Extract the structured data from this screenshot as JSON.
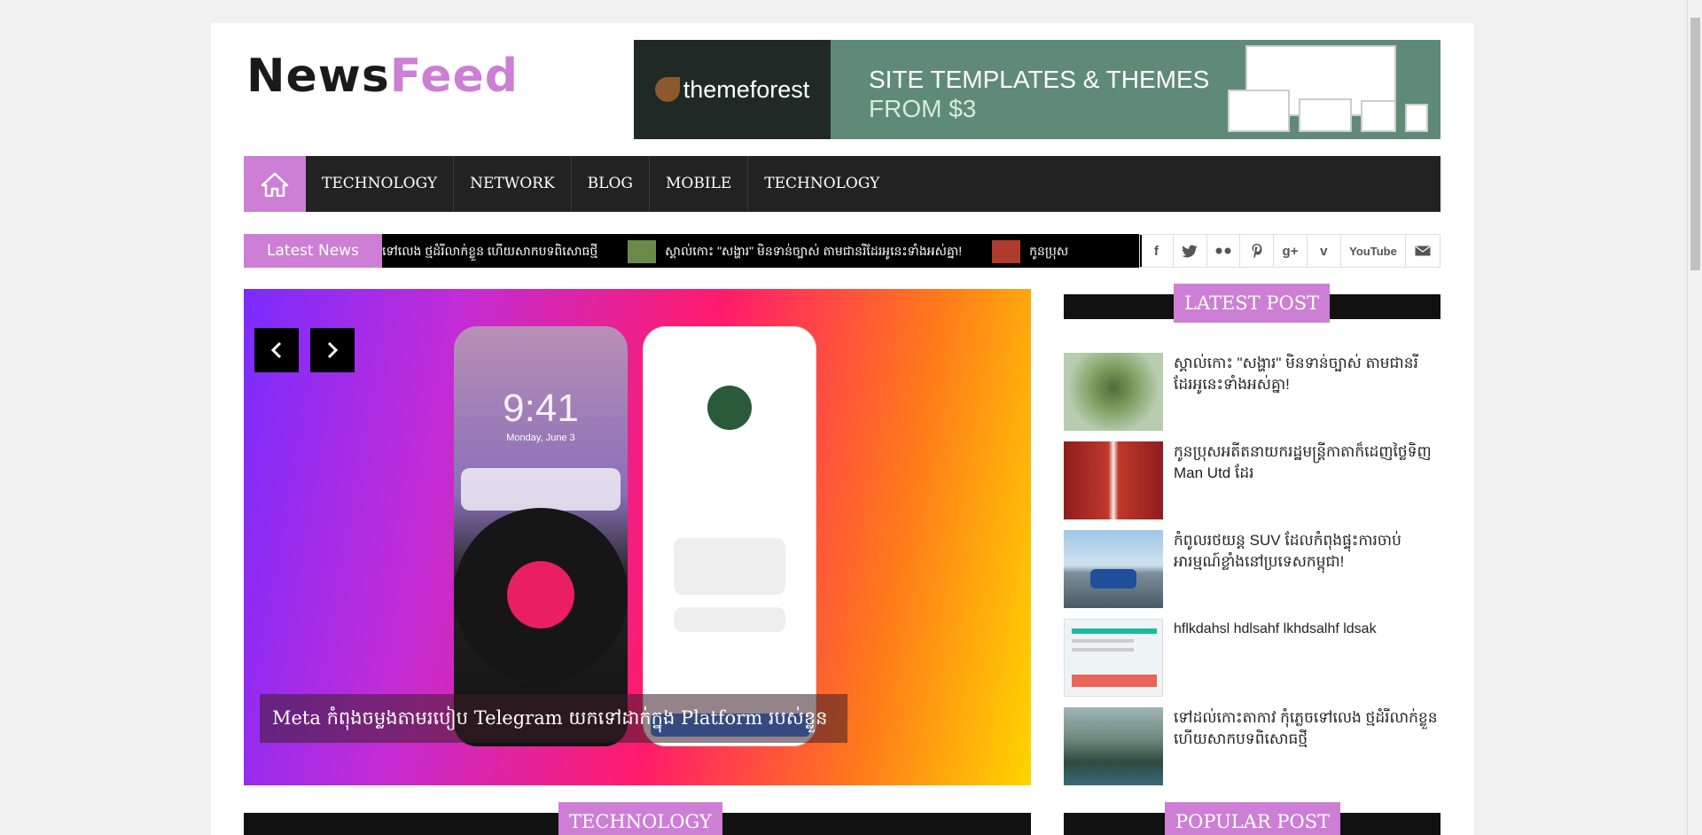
{
  "site": {
    "logo_part1": "News",
    "logo_part2": "Feed"
  },
  "banner": {
    "brand": "themeforest",
    "line1": "SITE TEMPLATES & THEMES",
    "line2": "FROM $3"
  },
  "nav": {
    "items": [
      "TECHNOLOGY",
      "NETWORK",
      "BLOG",
      "MOBILE",
      "TECHNOLOGY"
    ]
  },
  "ticker": {
    "label": "Latest News",
    "items": [
      "ទៅលេង ថ្មដំរីលាក់ខ្លួន ហើយសាកបទពិសោធថ្មី",
      "ស្គាល់កោះ \"សង្ហារ\" មិនទាន់ច្បាស់ តាមជានរីដែរអូនេះទាំងអស់គ្នា!",
      "កូនប្រុស"
    ]
  },
  "social": {
    "icons": [
      "facebook-icon",
      "twitter-icon",
      "flickr-icon",
      "pinterest-icon",
      "googleplus-icon",
      "vimeo-icon",
      "youtube-icon",
      "mail-icon"
    ],
    "youtube_label": "YouTube"
  },
  "slider": {
    "caption": "Meta កំពុងចម្លងតាមរបៀប Telegram យកទៅដាក់ក្នុង Platform របស់ខ្លួន",
    "phone_time": "9:41",
    "phone_day": "Monday, June 3"
  },
  "sections": {
    "technology": "TECHNOLOGY",
    "latest_post": "LATEST POST",
    "popular_post": "POPULAR POST"
  },
  "latest_posts": [
    {
      "title": "ស្គាល់កោះ \"សង្ហារ\" មិនទាន់ច្បាស់ តាមជានរីដែរអូនេះទាំងអស់គ្នា!",
      "color": "#8fb07a"
    },
    {
      "title": "កូនប្រុសអតីតនាយករដ្ឋមន្ត្រីកាតាក៏ដេញថ្លៃទិញ Man Utd ដែរ",
      "color": "#c0392b"
    },
    {
      "title": "កំពូលរថយន្ត SUV ដែលកំពុងផ្ទុះការចាប់អារម្មណ៍ខ្លាំងនៅប្រទេសកម្ពុជា!",
      "color": "#5a8fbf"
    },
    {
      "title": "hflkdahsl hdlsahf lkhdsalhf ldsak",
      "color": "#e8eef2"
    },
    {
      "title": "ទៅដល់កោះតាកាវ កុំភ្លេចទៅលេង ថ្មដំរីលាក់ខ្លួន ហើយសាកបទពិសោធថ្មី",
      "color": "#4f6b5a"
    }
  ]
}
